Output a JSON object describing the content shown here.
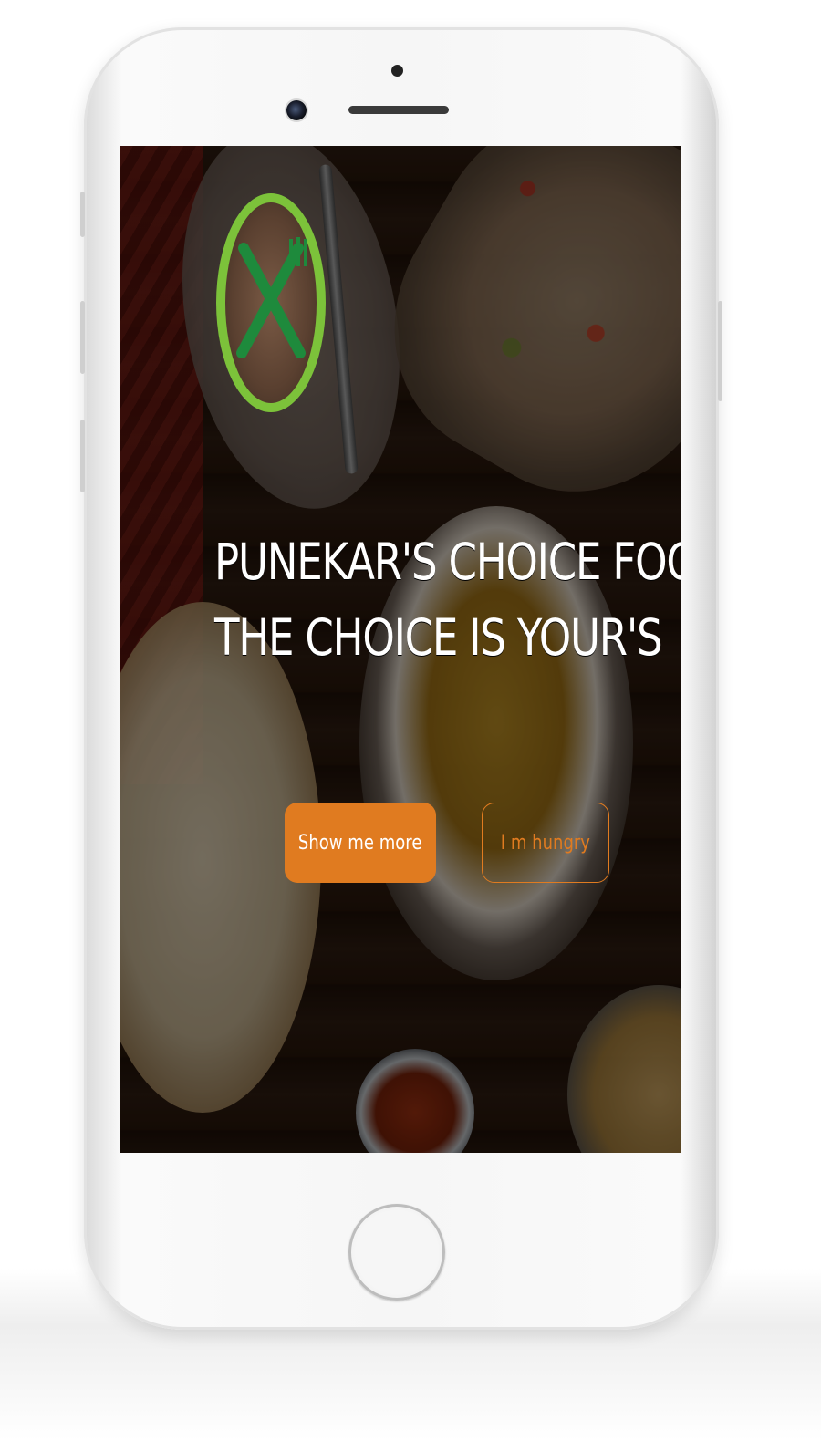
{
  "device": {
    "type": "smartphone",
    "frame_color": "#f6f6f6"
  },
  "app": {
    "logo": {
      "icon": "crossed-fork-knife-icon",
      "ring_color": "#7cc23a",
      "icon_color": "#1e8a3c"
    },
    "hero": {
      "line1": "PUNEKAR'S CHOICE FOOD",
      "line2": "THE CHOICE IS YOUR'S"
    },
    "buttons": {
      "primary_label": "Show me more",
      "secondary_label": "I m hungry",
      "accent_color": "#e07b20"
    }
  }
}
